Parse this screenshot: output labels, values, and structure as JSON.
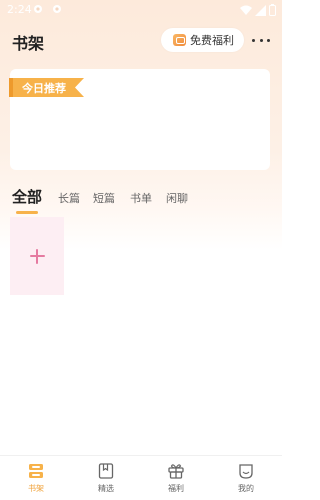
{
  "status_bar": {
    "time": "2:24"
  },
  "header": {
    "title": "书架",
    "welfare_label": "免费福利"
  },
  "recommend": {
    "label": "今日推荐"
  },
  "category_tabs": [
    {
      "label": "全部",
      "active": true
    },
    {
      "label": "长篇",
      "active": false
    },
    {
      "label": "短篇",
      "active": false
    },
    {
      "label": "书单",
      "active": false
    },
    {
      "label": "闲聊",
      "active": false
    }
  ],
  "bottom_nav": [
    {
      "label": "书架",
      "icon": "bookshelf-icon",
      "active": true
    },
    {
      "label": "精选",
      "icon": "book-icon",
      "active": false
    },
    {
      "label": "福利",
      "icon": "gift-icon",
      "active": false
    },
    {
      "label": "我的",
      "icon": "smile-icon",
      "active": false
    }
  ],
  "colors": {
    "accent": "#f7b24a",
    "nav_active": "#f0a23a",
    "add_tile_bg": "#fdeef3",
    "plus": "#e57aa0"
  }
}
